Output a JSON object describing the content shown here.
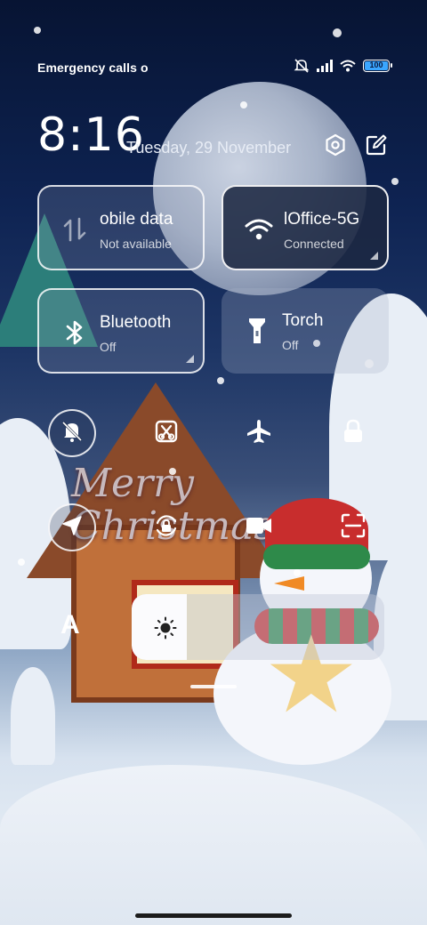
{
  "status_bar": {
    "carrier_text": "Emergency calls o",
    "battery_level": "100",
    "icons": [
      "mute-icon",
      "signal-icon",
      "wifi-icon",
      "battery-icon"
    ]
  },
  "header": {
    "time": "8:16",
    "date": "Tuesday, 29 November",
    "settings_icon": "settings-icon",
    "edit_icon": "edit-icon"
  },
  "tiles": [
    {
      "id": "mobile-data",
      "title": "obile data",
      "subtitle": "Not available",
      "icon": "mobile-data-icon",
      "state": "off"
    },
    {
      "id": "wifi",
      "title": "lOffice-5G",
      "subtitle": "Connected",
      "icon": "wifi-icon",
      "state": "on"
    },
    {
      "id": "bluetooth",
      "title": "Bluetooth",
      "subtitle": "Off",
      "icon": "bluetooth-icon",
      "state": "off"
    },
    {
      "id": "torch",
      "title": "Torch",
      "subtitle": "Off",
      "icon": "torch-icon",
      "state": "off"
    }
  ],
  "toggles_row1": [
    "silent-mode-icon",
    "screenshot-icon",
    "airplane-mode-icon",
    "lock-icon"
  ],
  "toggles_row2": [
    "location-icon",
    "rotation-lock-icon",
    "screen-record-icon",
    "scanner-icon"
  ],
  "brightness": {
    "auto_label": "A",
    "level": 0.22,
    "icon": "brightness-icon"
  },
  "wallpaper": {
    "greeting": "Merry Christmas"
  },
  "colors": {
    "tile_active_bg": "#1c2842",
    "battery_accent": "#3aa6ff"
  }
}
